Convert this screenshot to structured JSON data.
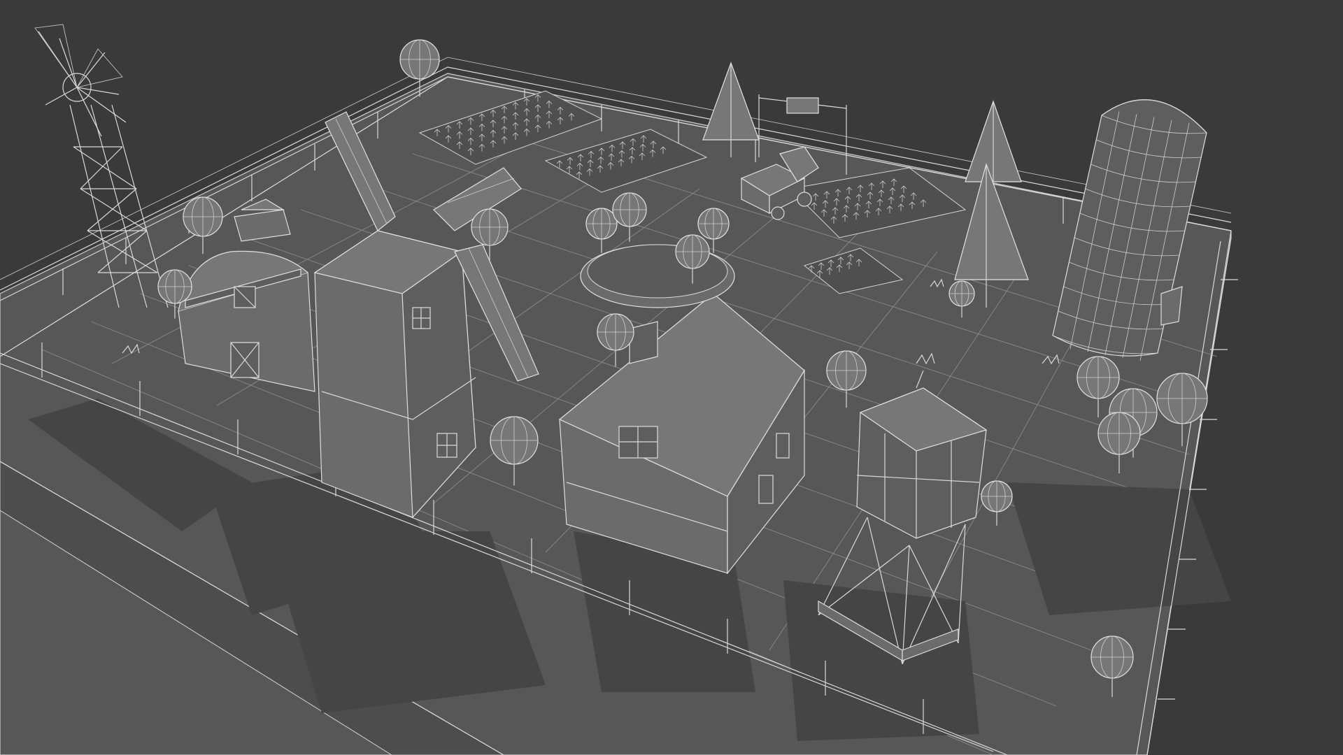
{
  "scene": {
    "description_free": true,
    "background_color": "#3a3a3a",
    "ground_color": "#5a5a5a",
    "wire_color": "#d9d9d9",
    "objects": [
      "windmill-tower",
      "barn",
      "tall-barn",
      "farmhouse",
      "silo",
      "water-tower",
      "windmill-blades",
      "tractor-trailer",
      "crop-fields",
      "pine-trees",
      "round-trees",
      "fence",
      "entrance-gate",
      "pond-ring"
    ]
  }
}
